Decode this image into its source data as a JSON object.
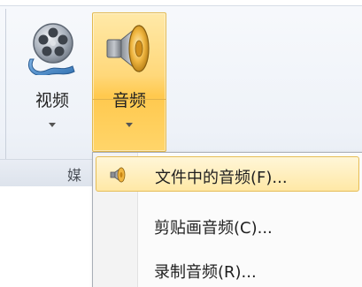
{
  "ribbon": {
    "group_label": "媒",
    "buttons": [
      {
        "id": "video",
        "label": "视频",
        "icon": "film-reel-icon"
      },
      {
        "id": "audio",
        "label": "音频",
        "icon": "speaker-icon",
        "state": "pressed"
      }
    ]
  },
  "menu": {
    "items": [
      {
        "label": "文件中的音频(F)...",
        "icon": "speaker-small-icon",
        "highlighted": true
      },
      {
        "label": "剪贴画音频(C)...",
        "icon": "",
        "highlighted": false
      },
      {
        "label": "录制音频(R)...",
        "icon": "",
        "highlighted": false
      }
    ]
  },
  "colors": {
    "accent_pressed": "#ffd56a",
    "menu_highlight": "#ffe8a6",
    "menu_highlight_border": "#e6bd56"
  }
}
